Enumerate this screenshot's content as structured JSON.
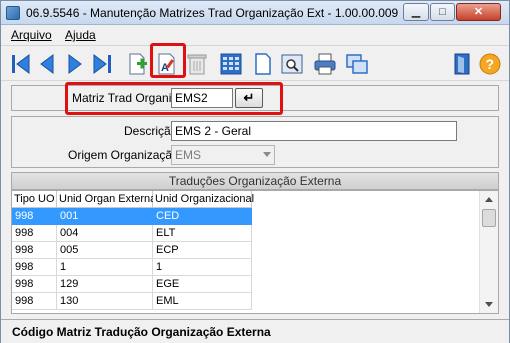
{
  "window": {
    "title": "06.9.5546 - Manutenção Matrizes Trad Organização Ext - 1.00.00.009"
  },
  "menu": [
    "Arquivo",
    "Ajuda"
  ],
  "toolbar": {
    "buttons": [
      {
        "name": "first-record-icon"
      },
      {
        "name": "previous-record-icon"
      },
      {
        "name": "next-record-icon"
      },
      {
        "name": "last-record-icon"
      },
      {
        "name": "add-record-icon"
      },
      {
        "name": "edit-record-icon"
      },
      {
        "name": "delete-record-icon"
      },
      {
        "name": "zoom-list-icon"
      },
      {
        "name": "copy-document-icon"
      },
      {
        "name": "preview-icon"
      },
      {
        "name": "print-icon"
      },
      {
        "name": "windows-icon"
      },
      {
        "name": "exit-door-icon"
      },
      {
        "name": "help-icon"
      }
    ],
    "help_glyph": "?"
  },
  "key_panel": {
    "label": "Matriz Trad Organiz:",
    "value": "EMS2",
    "go_glyph": "↵"
  },
  "detail": {
    "descricao_label": "Descrição:",
    "descricao_value": "EMS 2 - Geral",
    "origem_label": "Origem Organização:",
    "origem_value": "EMS"
  },
  "grid": {
    "title": "Traduções Organização Externa",
    "columns": [
      "Tipo UO",
      "Unid Organ Externa",
      "Unid Organizacional"
    ],
    "rows": [
      [
        "998",
        "001",
        "CED"
      ],
      [
        "998",
        "004",
        "ELT"
      ],
      [
        "998",
        "005",
        "ECP"
      ],
      [
        "998",
        "1",
        "1"
      ],
      [
        "998",
        "129",
        "EGE"
      ],
      [
        "998",
        "130",
        "EML"
      ]
    ],
    "selected_row": 0
  },
  "status": {
    "text": "Código Matriz Tradução Organização Externa"
  },
  "colors": {
    "selection": "#3399ff",
    "highlight": "#e01010"
  }
}
